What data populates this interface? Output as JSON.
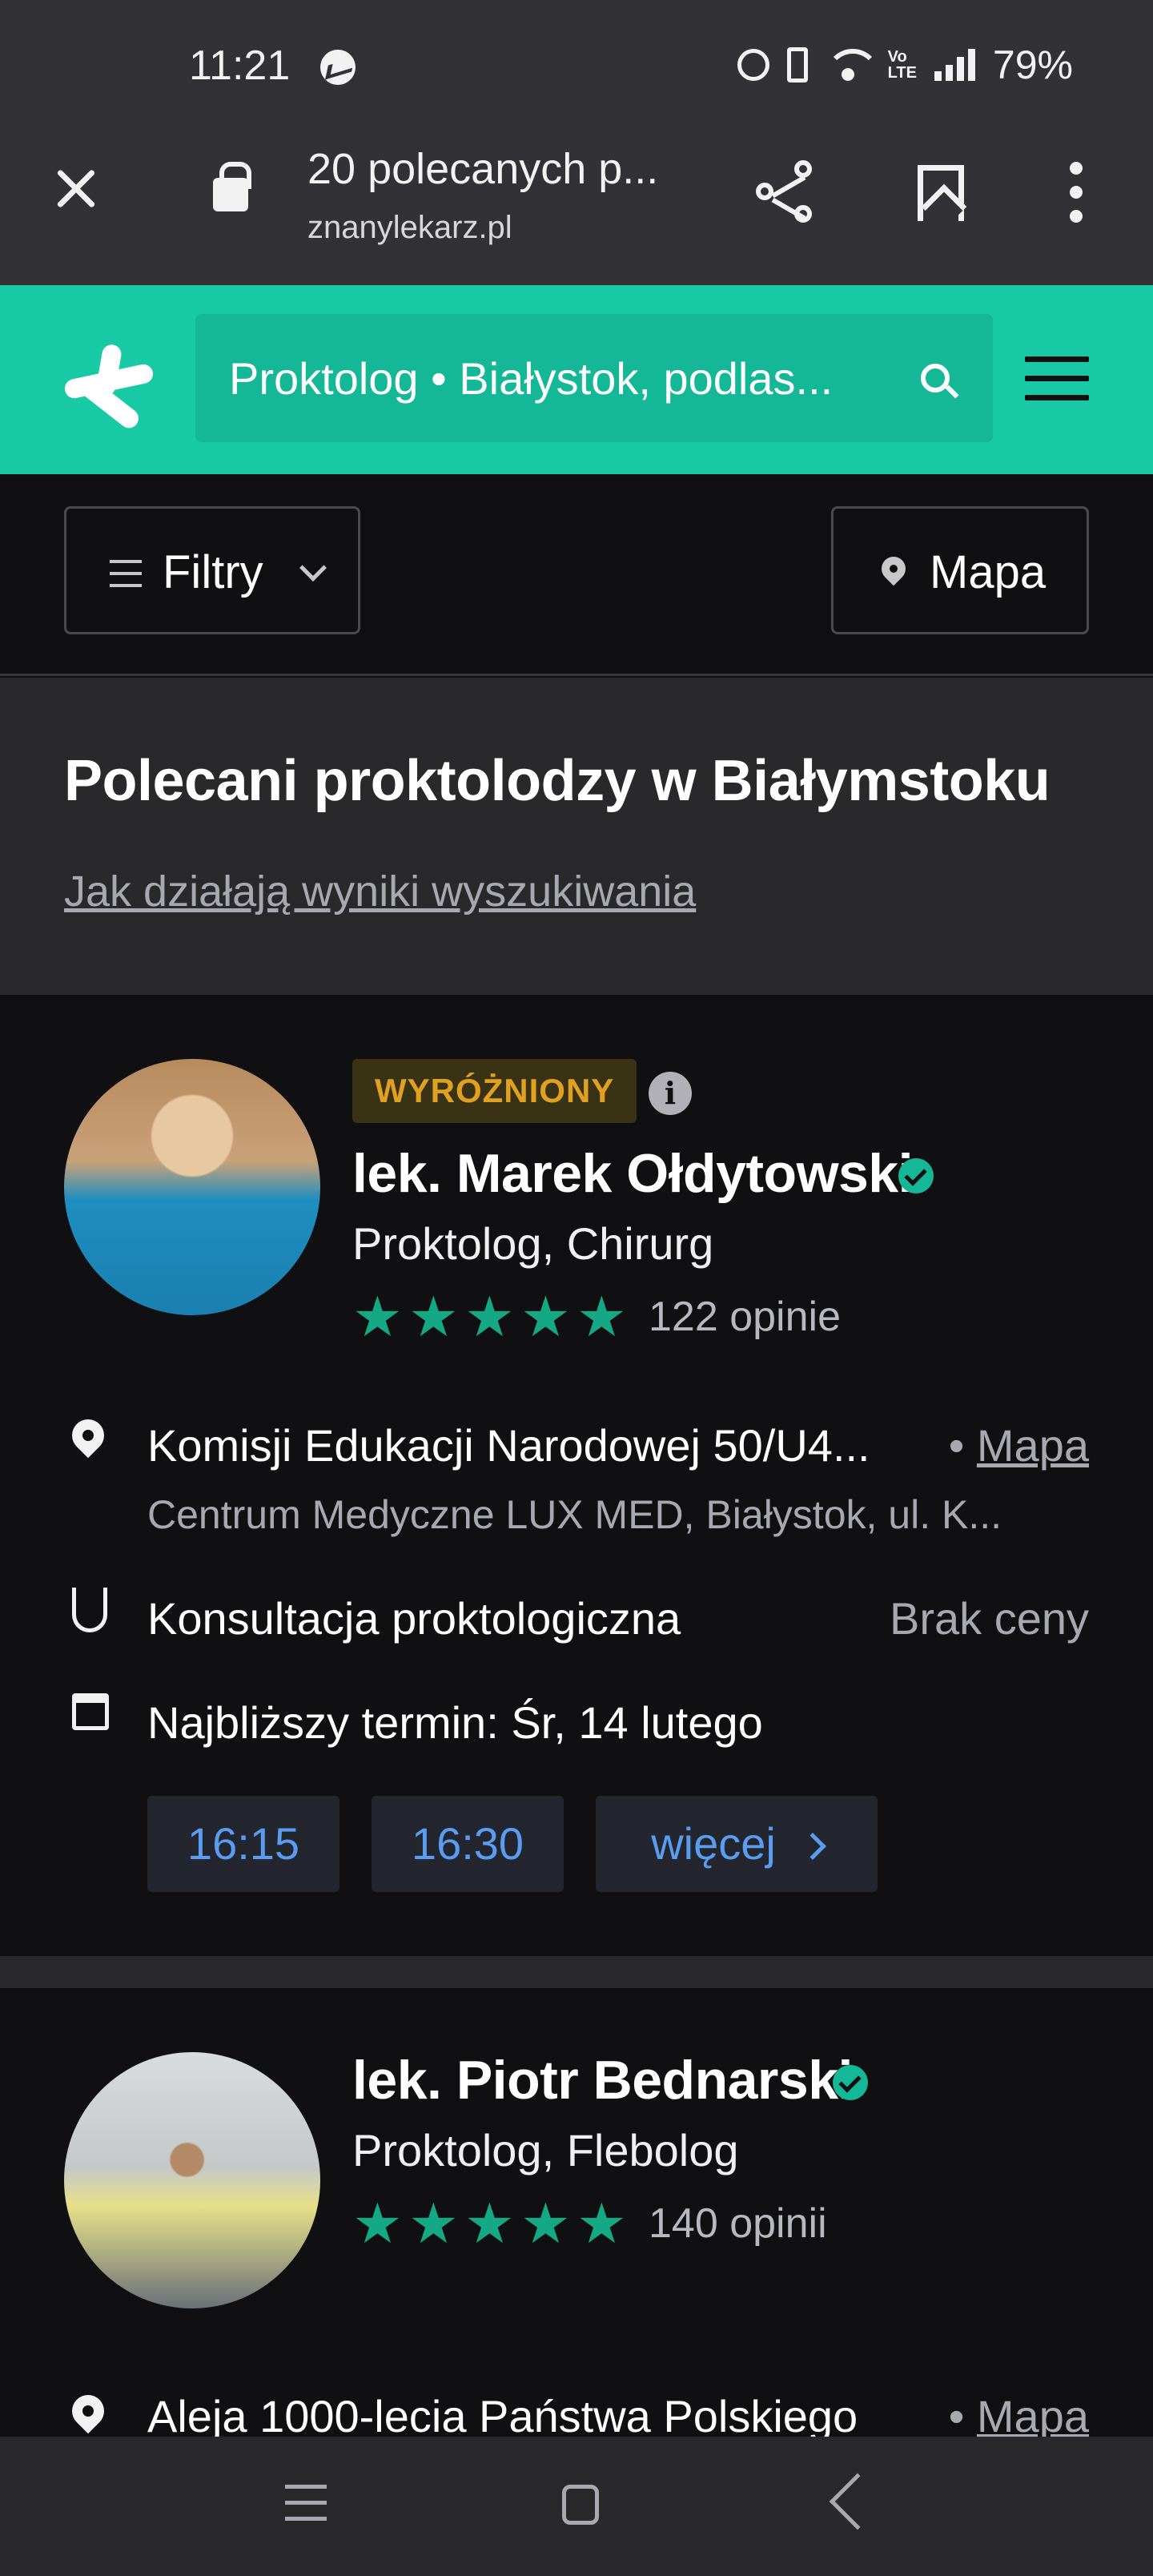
{
  "status_bar": {
    "time": "11:21",
    "battery": "79%",
    "network": "VoLTE"
  },
  "browser": {
    "tab_title": "20 polecanych p...",
    "url": "znanylekarz.pl"
  },
  "app_header": {
    "search_text": "Proktolog • Białystok, podlas..."
  },
  "filters": {
    "filters_label": "Filtry",
    "map_label": "Mapa"
  },
  "heading": {
    "title": "Polecani proktolodzy w Białymstoku",
    "how_it_works_link": "Jak działają wyniki wyszukiwania"
  },
  "doctors": [
    {
      "badge": "WYRÓŻNIONY",
      "name": "lek. Marek Ołdytowski",
      "specialties": "Proktolog, Chirurg",
      "rating_stars": 5,
      "reviews": "122 opinie",
      "address": "Komisji Edukacji Narodowej 50/U4...",
      "map_link": "Mapa",
      "facility": "Centrum Medyczne LUX MED, Białystok, ul. K...",
      "service": "Konsultacja proktologiczna",
      "price": "Brak ceny",
      "next_slot_label": "Najbliższy termin: Śr, 14 lutego",
      "slots": [
        "16:15",
        "16:30"
      ],
      "more_label": "więcej"
    },
    {
      "name": "lek. Piotr Bednarski",
      "specialties": "Proktolog, Flebolog",
      "rating_stars": 5,
      "reviews": "140 opinii",
      "address": "Aleja 1000-lecia Państwa Polskiego",
      "map_link": "Mapa"
    }
  ],
  "colors": {
    "brand": "#18c9a5",
    "accent_blue": "#5a9cf0",
    "star": "#14a884",
    "badge": "#e0a020"
  }
}
